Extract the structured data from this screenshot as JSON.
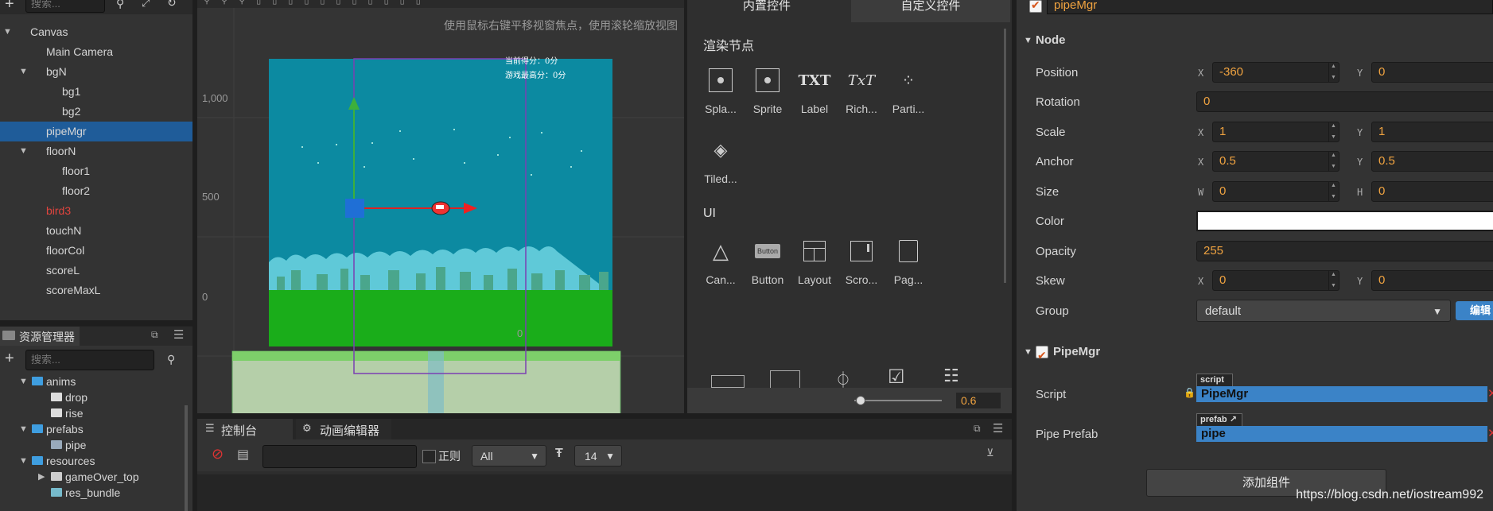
{
  "hierarchy": {
    "search_placeholder": "搜索...",
    "nodes": [
      {
        "label": "Canvas",
        "depth": 0,
        "expanded": true,
        "selected": false,
        "red": false
      },
      {
        "label": "Main Camera",
        "depth": 1,
        "expanded": null,
        "selected": false,
        "red": false
      },
      {
        "label": "bgN",
        "depth": 1,
        "expanded": true,
        "selected": false,
        "red": false
      },
      {
        "label": "bg1",
        "depth": 2,
        "expanded": null,
        "selected": false,
        "red": false
      },
      {
        "label": "bg2",
        "depth": 2,
        "expanded": null,
        "selected": false,
        "red": false
      },
      {
        "label": "pipeMgr",
        "depth": 1,
        "expanded": null,
        "selected": true,
        "red": false
      },
      {
        "label": "floorN",
        "depth": 1,
        "expanded": true,
        "selected": false,
        "red": false
      },
      {
        "label": "floor1",
        "depth": 2,
        "expanded": null,
        "selected": false,
        "red": false
      },
      {
        "label": "floor2",
        "depth": 2,
        "expanded": null,
        "selected": false,
        "red": false
      },
      {
        "label": "bird3",
        "depth": 1,
        "expanded": null,
        "selected": false,
        "red": true
      },
      {
        "label": "touchN",
        "depth": 1,
        "expanded": null,
        "selected": false,
        "red": false
      },
      {
        "label": "floorCol",
        "depth": 1,
        "expanded": null,
        "selected": false,
        "red": false
      },
      {
        "label": "scoreL",
        "depth": 1,
        "expanded": null,
        "selected": false,
        "red": false
      },
      {
        "label": "scoreMaxL",
        "depth": 1,
        "expanded": null,
        "selected": false,
        "red": false
      }
    ]
  },
  "assets": {
    "title": "资源管理器",
    "search_placeholder": "搜索...",
    "items": [
      {
        "label": "anims",
        "depth": 1,
        "kind": "folder",
        "expanded": true
      },
      {
        "label": "drop",
        "depth": 2,
        "kind": "anim",
        "expanded": null
      },
      {
        "label": "rise",
        "depth": 2,
        "kind": "anim",
        "expanded": null
      },
      {
        "label": "prefabs",
        "depth": 1,
        "kind": "folder",
        "expanded": true
      },
      {
        "label": "pipe",
        "depth": 2,
        "kind": "prefab",
        "expanded": null
      },
      {
        "label": "resources",
        "depth": 1,
        "kind": "folder",
        "expanded": true
      },
      {
        "label": "gameOver_top",
        "depth": 2,
        "kind": "label",
        "expanded": false
      },
      {
        "label": "res_bundle",
        "depth": 2,
        "kind": "image",
        "expanded": null
      }
    ]
  },
  "scene": {
    "hint": "使用鼠标右键平移视窗焦点，使用滚轮缩放视图",
    "y_ticks": [
      "1,000",
      "500",
      "0"
    ],
    "x_tick_fragment": "0",
    "game_score": "当前得分：0分",
    "game_best": "游戏最高分：0分"
  },
  "widgets": {
    "tabs": [
      "内置控件",
      "自定义控件"
    ],
    "render_title": "渲染节点",
    "render_items": [
      "Spla...",
      "Sprite",
      "Label",
      "Rich...",
      "Parti...",
      "Tiled..."
    ],
    "ui_title": "UI",
    "ui_items": [
      "Can...",
      "Button",
      "Layout",
      "Scro...",
      "Pag..."
    ],
    "button_icon_text": "Button",
    "txt_icon": "TXT",
    "rich_icon": "TxT",
    "zoom_value": "0.6"
  },
  "console": {
    "tabs": [
      "控制台",
      "动画编辑器"
    ],
    "regex_label": "正则",
    "filter_value": "All",
    "font_size": "14"
  },
  "inspector": {
    "node_name": "pipeMgr",
    "node_section": "Node",
    "position": {
      "label": "Position",
      "x": "-360",
      "y": "0"
    },
    "rotation": {
      "label": "Rotation",
      "value": "0"
    },
    "scale": {
      "label": "Scale",
      "x": "1",
      "y": "1"
    },
    "anchor": {
      "label": "Anchor",
      "x": "0.5",
      "y": "0.5"
    },
    "size": {
      "label": "Size",
      "w": "0",
      "h": "0"
    },
    "color": {
      "label": "Color",
      "value": "#ffffff"
    },
    "opacity": {
      "label": "Opacity",
      "value": "255"
    },
    "skew": {
      "label": "Skew",
      "x": "0",
      "y": "0"
    },
    "group": {
      "label": "Group",
      "value": "default",
      "edit_label": "编辑"
    },
    "component": {
      "name": "PipeMgr",
      "script_label": "Script",
      "script_tag": "script",
      "script_value": "PipeMgr",
      "prefab_label": "Pipe Prefab",
      "prefab_tag": "prefab",
      "prefab_value": "pipe"
    },
    "add_component_label": "添加组件",
    "axis": {
      "x": "X",
      "y": "Y",
      "w": "W",
      "h": "H"
    }
  },
  "watermark": "https://blog.csdn.net/iostream992",
  "colors": {
    "selection": "#1f5c99",
    "value_orange": "#f0a340",
    "sky": "#0c8aa1",
    "grass": "#1aad1a",
    "ground": "#b5cfa9",
    "script_blue": "#3b83c7"
  }
}
